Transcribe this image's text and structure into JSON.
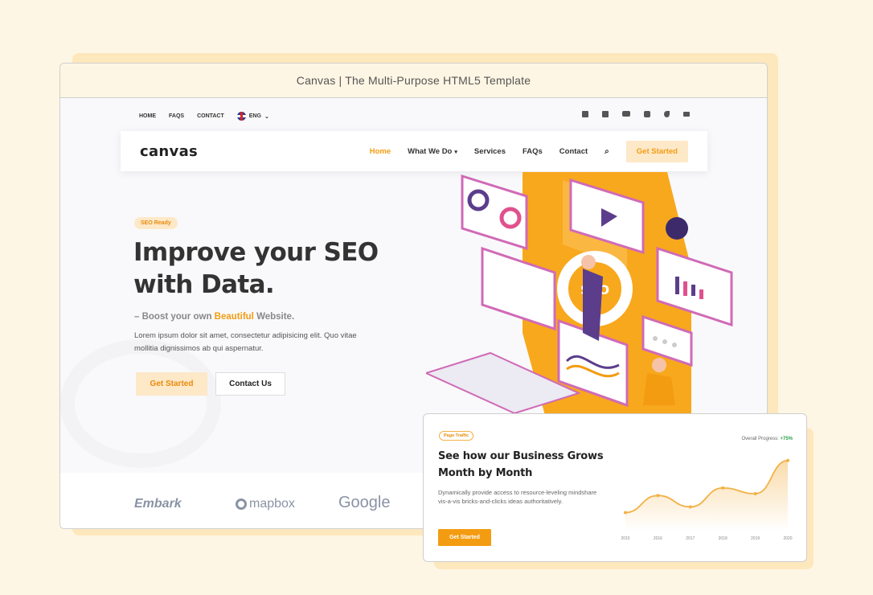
{
  "window": {
    "title": "Canvas | The Multi-Purpose HTML5 Template"
  },
  "topbar": {
    "links": [
      "HOME",
      "FAQS",
      "CONTACT"
    ],
    "language": "ENG",
    "social_icons": [
      "facebook-icon",
      "twitter-icon",
      "youtube-icon",
      "instagram-icon",
      "phone-icon",
      "email-icon"
    ]
  },
  "nav": {
    "logo": "canvas",
    "items": [
      "Home",
      "What We Do",
      "Services",
      "FAQs",
      "Contact"
    ],
    "cta": "Get Started"
  },
  "hero": {
    "badge": "SEO Ready",
    "title_line1": "Improve your SEO",
    "title_line2": "with Data.",
    "tagline_prefix": "– Boost your own ",
    "tagline_highlight": "Beautiful",
    "tagline_suffix": " Website.",
    "body": "Lorem ipsum dolor sit amet, consectetur adipisicing elit. Quo vitae mollitia dignissimos ab qui aspernatur.",
    "btn_primary": "Get Started",
    "btn_secondary": "Contact Us",
    "illustration_label": "SEO"
  },
  "brands": {
    "embark": "Embark",
    "mapbox": "mapbox",
    "google": "Google"
  },
  "card": {
    "badge": "Page Traffic",
    "title": "See how our Business Grows Month by Month",
    "description": "Dynamically provide access to resource-leveling mindshare vis-a-vis bricks-and-clicks ideas authoritatively.",
    "button": "Get Started",
    "progress_label": "Overall Progress:",
    "progress_value": "+75%"
  },
  "chart_data": {
    "type": "area",
    "categories": [
      "2015",
      "2016",
      "2017",
      "2018",
      "2019",
      "2020"
    ],
    "values": [
      20,
      38,
      26,
      46,
      40,
      75
    ],
    "ylim": [
      0,
      85
    ],
    "grid": false,
    "color": "#f3b144"
  },
  "colors": {
    "accent": "#f39c12",
    "accent_light": "#fde8c8",
    "page_bg": "#fef6e4"
  }
}
